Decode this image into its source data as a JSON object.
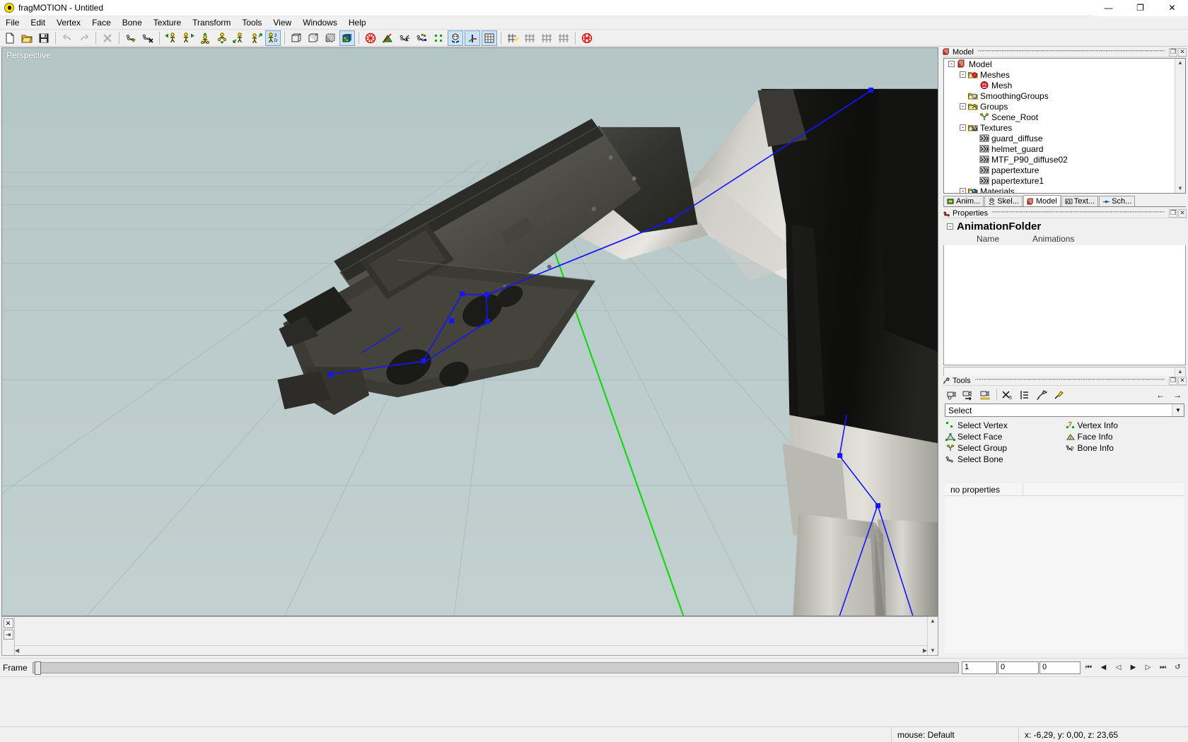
{
  "window": {
    "title": "fragMOTION - Untitled",
    "app_icon": "smiley-icon",
    "minimize": "—",
    "maximize": "❐",
    "close": "✕"
  },
  "menubar": {
    "items": [
      {
        "label": "File"
      },
      {
        "label": "Edit"
      },
      {
        "label": "Vertex"
      },
      {
        "label": "Face"
      },
      {
        "label": "Bone"
      },
      {
        "label": "Texture"
      },
      {
        "label": "Transform"
      },
      {
        "label": "Tools"
      },
      {
        "label": "View"
      },
      {
        "label": "Windows"
      },
      {
        "label": "Help"
      }
    ]
  },
  "toolbar": {
    "groups": [
      {
        "buttons": [
          {
            "name": "new-file-icon",
            "active": false
          },
          {
            "name": "open-file-icon",
            "active": false
          },
          {
            "name": "save-file-icon",
            "active": false
          }
        ]
      },
      {
        "buttons": [
          {
            "name": "undo-icon",
            "active": false
          },
          {
            "name": "redo-icon",
            "active": false
          }
        ]
      },
      {
        "buttons": [
          {
            "name": "delete-icon",
            "active": false
          }
        ]
      },
      {
        "buttons": [
          {
            "name": "bone-select-icon",
            "active": false
          },
          {
            "name": "bone-delete-icon",
            "active": false
          }
        ]
      },
      {
        "buttons": [
          {
            "name": "figure-move-left-icon",
            "active": false
          },
          {
            "name": "figure-move-right-icon",
            "active": false
          },
          {
            "name": "figure-move-up-icon",
            "active": false
          },
          {
            "name": "figure-move-down-icon",
            "active": false
          },
          {
            "name": "figure-rotate-left-icon",
            "active": false
          },
          {
            "name": "figure-rotate-right-icon",
            "active": false
          },
          {
            "name": "figure-3d-icon",
            "active": true
          }
        ]
      },
      {
        "buttons": [
          {
            "name": "box-wireframe-icon",
            "active": false
          },
          {
            "name": "box-flat-icon",
            "active": false
          },
          {
            "name": "box-shaded-icon",
            "active": false
          },
          {
            "name": "box-textured-icon",
            "active": true
          }
        ]
      },
      {
        "buttons": [
          {
            "name": "target-icon",
            "active": false
          },
          {
            "name": "face-normal-icon",
            "active": false
          },
          {
            "name": "axis-bone-icon",
            "active": false
          },
          {
            "name": "axis-joint-icon",
            "active": false
          },
          {
            "name": "vertex-dots-icon",
            "active": false
          },
          {
            "name": "skeleton-icon",
            "active": true
          },
          {
            "name": "axis-gizmo-icon",
            "active": true
          },
          {
            "name": "grid-icon",
            "active": true
          }
        ]
      },
      {
        "buttons": [
          {
            "name": "mesh-add-icon",
            "active": false
          },
          {
            "name": "mesh-sub-1-icon",
            "active": false
          },
          {
            "name": "mesh-sub-2-icon",
            "active": false
          },
          {
            "name": "mesh-sub-3-icon",
            "active": false
          }
        ]
      },
      {
        "buttons": [
          {
            "name": "sphere-wire-icon",
            "active": false
          }
        ]
      }
    ]
  },
  "viewport": {
    "label": "Perspective",
    "background_color": "#b9c9c9",
    "grid_color": "#a7b8b8",
    "axis_z_color": "#00d000",
    "bone_color": "#0000ff",
    "joint_color": "#0000ff"
  },
  "model_panel": {
    "title": "Model",
    "icon": "model-panel-icon",
    "close_label": "✕",
    "float_label": "❐",
    "tree": [
      {
        "label": "Model",
        "depth": 0,
        "expander": "-",
        "icon": "model-icon"
      },
      {
        "label": "Meshes",
        "depth": 1,
        "expander": "-",
        "icon": "folder-mesh-icon"
      },
      {
        "label": "Mesh",
        "depth": 2,
        "expander": "",
        "icon": "mesh-icon"
      },
      {
        "label": "SmoothingGroups",
        "depth": 1,
        "expander": "",
        "icon": "folder-smoothing-icon"
      },
      {
        "label": "Groups",
        "depth": 1,
        "expander": "-",
        "icon": "folder-groups-icon"
      },
      {
        "label": "Scene_Root",
        "depth": 2,
        "expander": "",
        "icon": "group-node-icon"
      },
      {
        "label": "Textures",
        "depth": 1,
        "expander": "-",
        "icon": "folder-textures-icon"
      },
      {
        "label": "guard_diffuse",
        "depth": 2,
        "expander": "",
        "icon": "texture-icon"
      },
      {
        "label": "helmet_guard",
        "depth": 2,
        "expander": "",
        "icon": "texture-icon"
      },
      {
        "label": "MTF_P90_diffuse02",
        "depth": 2,
        "expander": "",
        "icon": "texture-icon"
      },
      {
        "label": "papertexture",
        "depth": 2,
        "expander": "",
        "icon": "texture-icon"
      },
      {
        "label": "papertexture1",
        "depth": 2,
        "expander": "",
        "icon": "texture-icon"
      },
      {
        "label": "Materials",
        "depth": 1,
        "expander": "-",
        "icon": "folder-materials-icon"
      }
    ]
  },
  "dock_tabs": [
    {
      "label": "Anim...",
      "icon": "animation-tab-icon",
      "active": false
    },
    {
      "label": "Skel...",
      "icon": "skeleton-tab-icon",
      "active": false
    },
    {
      "label": "Model",
      "icon": "model-tab-icon",
      "active": true
    },
    {
      "label": "Text...",
      "icon": "texture-tab-icon",
      "active": false
    },
    {
      "label": "Sch...",
      "icon": "schematic-tab-icon",
      "active": false
    }
  ],
  "properties_panel": {
    "title": "Properties",
    "icon": "properties-panel-icon",
    "close_label": "✕",
    "float_label": "❐",
    "header": "AnimationFolder",
    "header_expander": "-",
    "columns": [
      "Name",
      "Animations"
    ]
  },
  "tools_panel": {
    "title": "Tools",
    "icon": "tools-panel-icon",
    "close_label": "✕",
    "float_label": "❐",
    "buttons": [
      {
        "name": "tool-camera-icon"
      },
      {
        "name": "tool-camera-next-icon"
      },
      {
        "name": "tool-camera-measure-icon"
      },
      {
        "name": "tool-wand-icon"
      },
      {
        "name": "tool-list-icon"
      },
      {
        "name": "tool-hammer-icon"
      },
      {
        "name": "tool-paint-icon"
      }
    ],
    "nav_prev": "←",
    "nav_next": "→",
    "selected_mode": "Select",
    "actions": [
      {
        "label": "Select Vertex",
        "icon": "select-vertex-icon"
      },
      {
        "label": "Vertex Info",
        "icon": "vertex-info-icon"
      },
      {
        "label": "Select Face",
        "icon": "select-face-icon"
      },
      {
        "label": "Face Info",
        "icon": "face-info-icon"
      },
      {
        "label": "Select Group",
        "icon": "select-group-icon"
      },
      {
        "label": "Bone Info",
        "icon": "bone-info-icon"
      },
      {
        "label": "Select Bone",
        "icon": "select-bone-icon"
      }
    ],
    "no_properties": "no properties"
  },
  "timeline": {
    "close_label": "✕",
    "pin_label": "⇥"
  },
  "framebar": {
    "label": "Frame",
    "current_frame": "1",
    "start_frame": "0",
    "end_frame": "0",
    "controls": [
      {
        "name": "go-first-frame-button",
        "glyph": "⏮"
      },
      {
        "name": "step-back-button",
        "glyph": "◀"
      },
      {
        "name": "play-reverse-button",
        "glyph": "◁"
      },
      {
        "name": "play-button",
        "glyph": "▶"
      },
      {
        "name": "step-forward-button",
        "glyph": "▷"
      },
      {
        "name": "go-last-frame-button",
        "glyph": "⏭"
      },
      {
        "name": "loop-button",
        "glyph": "↺"
      }
    ]
  },
  "statusbar": {
    "mouse": "mouse: Default",
    "coords": "x: -6,29, y: 0,00, z: 23,65"
  }
}
